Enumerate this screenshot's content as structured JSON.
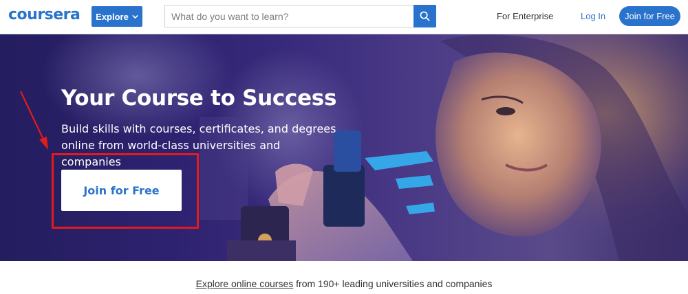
{
  "header": {
    "logo": "coursera",
    "explore_label": "Explore",
    "search_placeholder": "What do you want to learn?",
    "search_value": "",
    "enterprise_label": "For Enterprise",
    "login_label": "Log In",
    "join_label": "Join for Free"
  },
  "hero": {
    "title": "Your Course to Success",
    "subtitle": "Build skills with courses, certificates, and degrees online from world-class universities and companies",
    "cta_label": "Join for Free"
  },
  "explore_strip": {
    "link_text": "Explore online courses",
    "rest_text": " from 190+ leading universities and companies"
  },
  "colors": {
    "brand_blue": "#2a73cc",
    "annotation_red": "#e21b1b",
    "hero_purple": "#2d2270"
  },
  "icons": {
    "search": "search-icon",
    "explore_dropdown": "chevron-down-icon",
    "annotation_arrow": "arrow-icon"
  }
}
